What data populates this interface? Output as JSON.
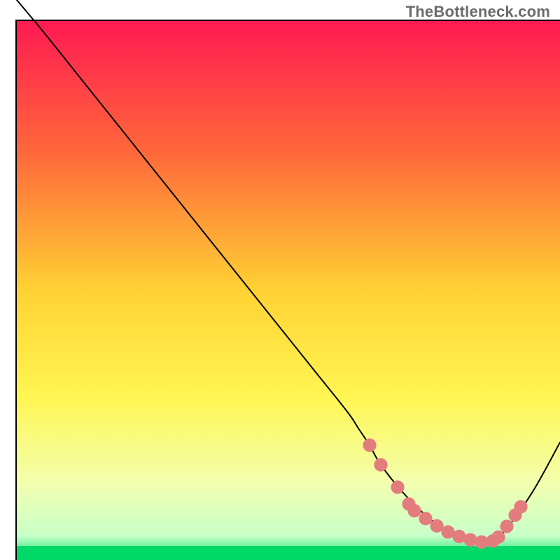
{
  "watermark": "TheBottleneck.com",
  "chart_data": {
    "type": "line",
    "title": "",
    "xlabel": "",
    "ylabel": "",
    "xlim": [
      0,
      100
    ],
    "ylim": [
      0,
      100
    ],
    "background": {
      "type": "vertical-gradient",
      "stops": [
        {
          "offset": 0.0,
          "color": "#ff1a52"
        },
        {
          "offset": 0.25,
          "color": "#ff6a3a"
        },
        {
          "offset": 0.5,
          "color": "#ffd233"
        },
        {
          "offset": 0.7,
          "color": "#fff653"
        },
        {
          "offset": 0.86,
          "color": "#f2ffb0"
        },
        {
          "offset": 0.955,
          "color": "#c8ffc8"
        },
        {
          "offset": 1.0,
          "color": "#00e070"
        }
      ]
    },
    "series": [
      {
        "name": "bottleneck-curve",
        "color": "#000000",
        "width": 2,
        "x": [
          3,
          8,
          14,
          20,
          26,
          32,
          38,
          44,
          50,
          56,
          62,
          64,
          66,
          68,
          72,
          76,
          80,
          84,
          86,
          88,
          90,
          95,
          100
        ],
        "y": [
          100,
          94,
          86.5,
          79,
          71.5,
          64,
          56.5,
          49,
          41.5,
          34,
          26.5,
          23.5,
          20.5,
          17,
          12,
          8,
          5,
          3.5,
          3.2,
          3.4,
          5,
          12,
          21
        ]
      }
    ],
    "data_marker_band": {
      "color": "#e37d7d",
      "radius_percent": 1.2,
      "points_xy_percent": [
        [
          66,
          20.5
        ],
        [
          68,
          17
        ],
        [
          71,
          13
        ],
        [
          73,
          10
        ],
        [
          74,
          8.8
        ],
        [
          76,
          7.4
        ],
        [
          78,
          6.1
        ],
        [
          80,
          5
        ],
        [
          82,
          4.2
        ],
        [
          84,
          3.6
        ],
        [
          86,
          3.2
        ],
        [
          88,
          3.4
        ],
        [
          89,
          4.1
        ],
        [
          90.5,
          6
        ],
        [
          92,
          8
        ],
        [
          93,
          9.5
        ]
      ]
    },
    "frame": {
      "left_percent": 3,
      "right_percent": 100,
      "top_percent": 100,
      "bottom_percent": 0
    }
  }
}
